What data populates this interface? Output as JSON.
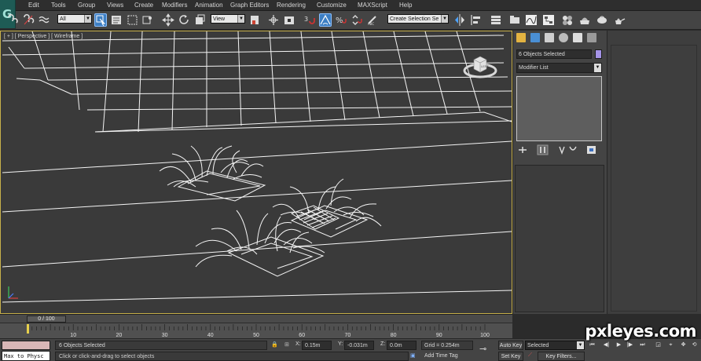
{
  "menubar": {
    "items": [
      "Edit",
      "Tools",
      "Group",
      "Views",
      "Create",
      "Modifiers",
      "Animation",
      "Graph Editors",
      "Rendering",
      "Customize",
      "MAXScript",
      "Help"
    ]
  },
  "toolbar": {
    "filter_value": "All",
    "refcoord_value": "View",
    "selection_set_placeholder": "Create Selection Se",
    "icons": [
      "select-link-icon",
      "unlink-icon",
      "bind-spacewarp-icon",
      "select-object-icon",
      "select-by-name-icon",
      "rect-region-icon",
      "window-crossing-icon",
      "move-icon",
      "rotate-icon",
      "scale-icon",
      "pivot-icon",
      "snap-3d-icon",
      "angle-snap-icon",
      "percent-snap-icon",
      "spinner-snap-icon",
      "mirror-icon",
      "align-icon",
      "layer-icon",
      "ribbon-icon",
      "curve-editor-icon",
      "schematic-icon",
      "material-editor-icon",
      "render-setup-icon",
      "rendered-frame-icon",
      "render-icon"
    ]
  },
  "viewport": {
    "label": "[ + ] [ Perspective ] [ Wireframe ]",
    "viewcube_face": "LEFT",
    "accent_color": "#c7b04a",
    "wire_color": "#ffffff"
  },
  "command_panel": {
    "tabs": [
      "create-tab-icon",
      "modify-tab-icon",
      "hierarchy-tab-icon",
      "motion-tab-icon",
      "display-tab-icon",
      "utilities-tab-icon"
    ],
    "selection_text": "6 Objects Selected",
    "swatch_color": "#a493e6",
    "modifier_list": "Modifier List"
  },
  "timeline": {
    "slider_text": "0 / 100",
    "ticks": [
      "10",
      "20",
      "30",
      "40",
      "50",
      "60",
      "70",
      "80",
      "90",
      "100"
    ]
  },
  "status": {
    "maxscript_output": "Max to Physc",
    "objects_selected": "6 Objects Selected",
    "prompt": "Click or click-and-drag to select objects",
    "x_label": "X:",
    "x_value": "0.15m",
    "y_label": "Y:",
    "y_value": "-0.031m",
    "z_label": "Z:",
    "z_value": "0.0m",
    "grid": "Grid = 0.254m",
    "add_time_tag": "Add Time Tag",
    "auto_key": "Auto Key",
    "set_key": "Set Key",
    "selected": "Selected",
    "key_filters": "Key Filters..."
  },
  "watermark": "pxleyes.com"
}
